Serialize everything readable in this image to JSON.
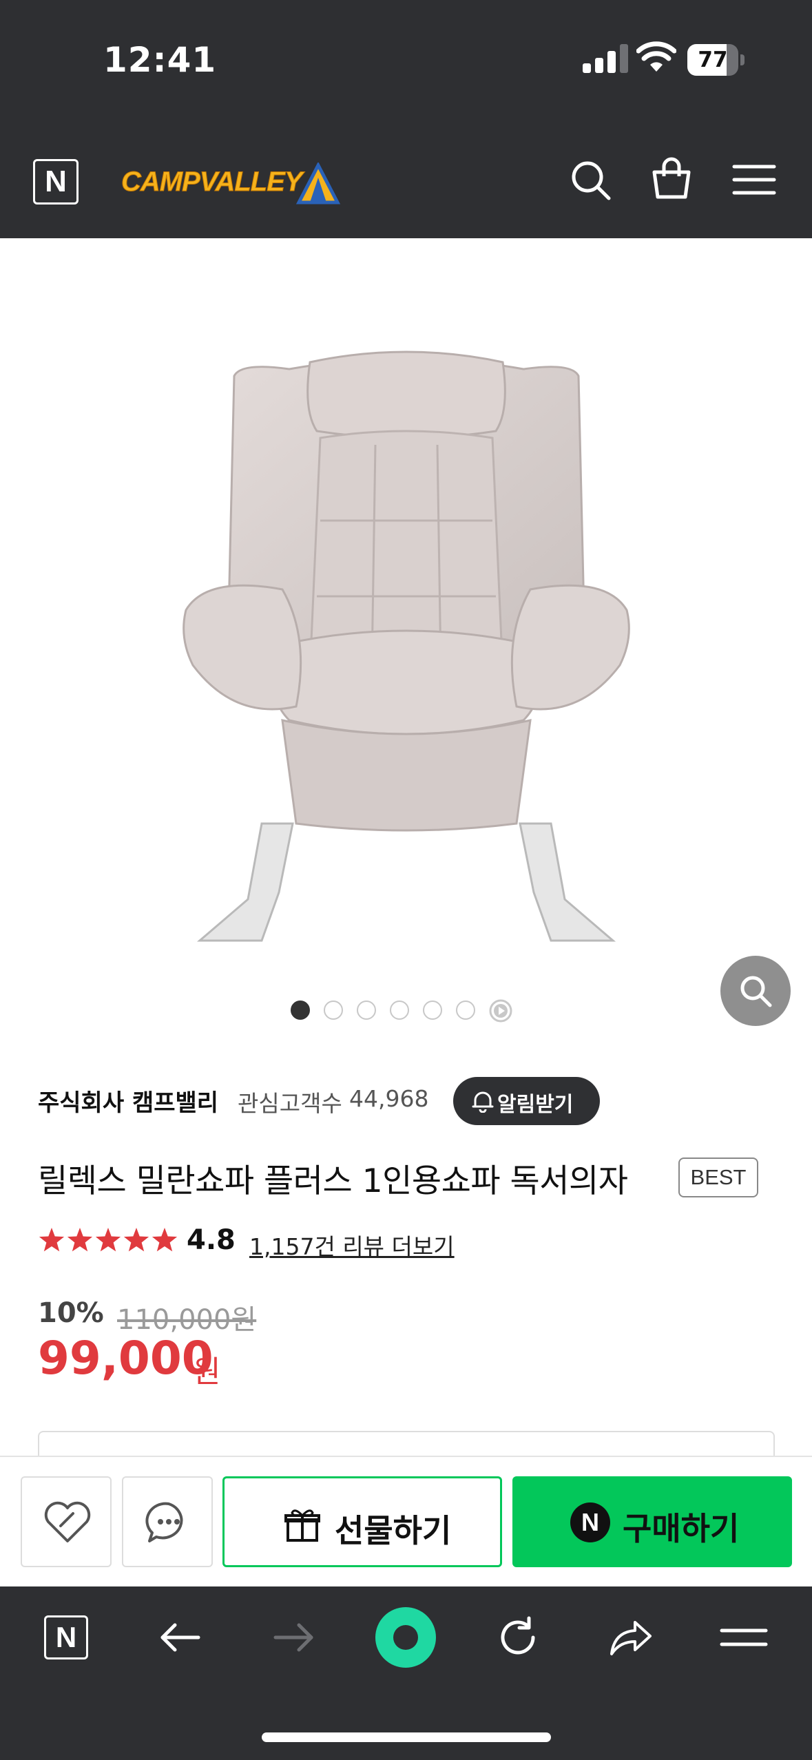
{
  "status_bar": {
    "time": "12:41",
    "battery_level": "77",
    "battery_fraction": 0.77
  },
  "header": {
    "naver_logo": "N",
    "brand_logo": "CAMPVALLEY"
  },
  "gallery": {
    "image_count": 7,
    "current_index": 1
  },
  "seller": {
    "name": "주식회사 캠프밸리",
    "fan_label": "관심고객수",
    "fan_count": "44,968",
    "alarm_label": "알림받기"
  },
  "product": {
    "title": "릴렉스 밀란쇼파 플러스 1인용쇼파 독서의자",
    "badge": "BEST",
    "rating": "4.8",
    "rating_stars": 5,
    "review_link": "1,157건 리뷰 더보기",
    "discount": "10%",
    "original_price": "110,000원",
    "price": "99,000",
    "price_unit": "원"
  },
  "actions": {
    "gift_label": "선물하기",
    "buy_label": "구매하기",
    "buy_icon_text": "N"
  },
  "browser_toolbar": {
    "home_label": "N"
  },
  "colors": {
    "dark_bar": "#2e2f32",
    "price_red": "#e03a3e",
    "naver_green": "#03c75a",
    "star_red": "#e03a3e"
  }
}
